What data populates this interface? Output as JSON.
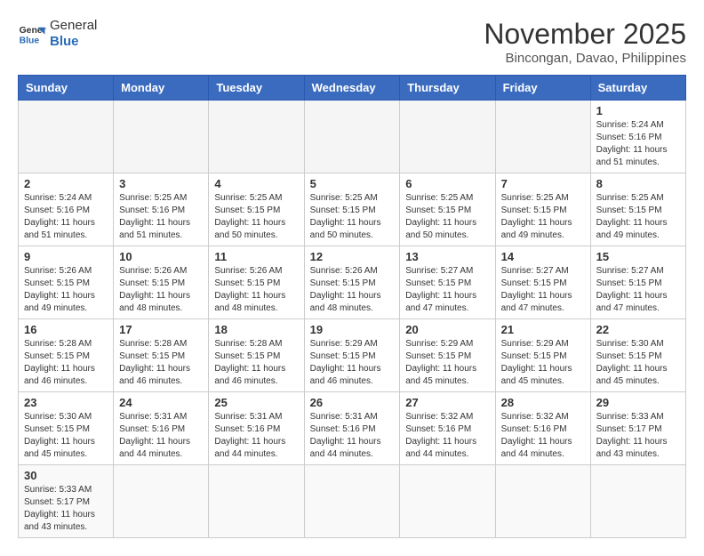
{
  "header": {
    "logo_text_general": "General",
    "logo_text_blue": "Blue",
    "month_title": "November 2025",
    "location": "Bincongan, Davao, Philippines"
  },
  "weekdays": [
    "Sunday",
    "Monday",
    "Tuesday",
    "Wednesday",
    "Thursday",
    "Friday",
    "Saturday"
  ],
  "weeks": [
    [
      {
        "day": "",
        "info": ""
      },
      {
        "day": "",
        "info": ""
      },
      {
        "day": "",
        "info": ""
      },
      {
        "day": "",
        "info": ""
      },
      {
        "day": "",
        "info": ""
      },
      {
        "day": "",
        "info": ""
      },
      {
        "day": "1",
        "info": "Sunrise: 5:24 AM\nSunset: 5:16 PM\nDaylight: 11 hours\nand 51 minutes."
      }
    ],
    [
      {
        "day": "2",
        "info": "Sunrise: 5:24 AM\nSunset: 5:16 PM\nDaylight: 11 hours\nand 51 minutes."
      },
      {
        "day": "3",
        "info": "Sunrise: 5:25 AM\nSunset: 5:16 PM\nDaylight: 11 hours\nand 51 minutes."
      },
      {
        "day": "4",
        "info": "Sunrise: 5:25 AM\nSunset: 5:15 PM\nDaylight: 11 hours\nand 50 minutes."
      },
      {
        "day": "5",
        "info": "Sunrise: 5:25 AM\nSunset: 5:15 PM\nDaylight: 11 hours\nand 50 minutes."
      },
      {
        "day": "6",
        "info": "Sunrise: 5:25 AM\nSunset: 5:15 PM\nDaylight: 11 hours\nand 50 minutes."
      },
      {
        "day": "7",
        "info": "Sunrise: 5:25 AM\nSunset: 5:15 PM\nDaylight: 11 hours\nand 49 minutes."
      },
      {
        "day": "8",
        "info": "Sunrise: 5:25 AM\nSunset: 5:15 PM\nDaylight: 11 hours\nand 49 minutes."
      }
    ],
    [
      {
        "day": "9",
        "info": "Sunrise: 5:26 AM\nSunset: 5:15 PM\nDaylight: 11 hours\nand 49 minutes."
      },
      {
        "day": "10",
        "info": "Sunrise: 5:26 AM\nSunset: 5:15 PM\nDaylight: 11 hours\nand 48 minutes."
      },
      {
        "day": "11",
        "info": "Sunrise: 5:26 AM\nSunset: 5:15 PM\nDaylight: 11 hours\nand 48 minutes."
      },
      {
        "day": "12",
        "info": "Sunrise: 5:26 AM\nSunset: 5:15 PM\nDaylight: 11 hours\nand 48 minutes."
      },
      {
        "day": "13",
        "info": "Sunrise: 5:27 AM\nSunset: 5:15 PM\nDaylight: 11 hours\nand 47 minutes."
      },
      {
        "day": "14",
        "info": "Sunrise: 5:27 AM\nSunset: 5:15 PM\nDaylight: 11 hours\nand 47 minutes."
      },
      {
        "day": "15",
        "info": "Sunrise: 5:27 AM\nSunset: 5:15 PM\nDaylight: 11 hours\nand 47 minutes."
      }
    ],
    [
      {
        "day": "16",
        "info": "Sunrise: 5:28 AM\nSunset: 5:15 PM\nDaylight: 11 hours\nand 46 minutes."
      },
      {
        "day": "17",
        "info": "Sunrise: 5:28 AM\nSunset: 5:15 PM\nDaylight: 11 hours\nand 46 minutes."
      },
      {
        "day": "18",
        "info": "Sunrise: 5:28 AM\nSunset: 5:15 PM\nDaylight: 11 hours\nand 46 minutes."
      },
      {
        "day": "19",
        "info": "Sunrise: 5:29 AM\nSunset: 5:15 PM\nDaylight: 11 hours\nand 46 minutes."
      },
      {
        "day": "20",
        "info": "Sunrise: 5:29 AM\nSunset: 5:15 PM\nDaylight: 11 hours\nand 45 minutes."
      },
      {
        "day": "21",
        "info": "Sunrise: 5:29 AM\nSunset: 5:15 PM\nDaylight: 11 hours\nand 45 minutes."
      },
      {
        "day": "22",
        "info": "Sunrise: 5:30 AM\nSunset: 5:15 PM\nDaylight: 11 hours\nand 45 minutes."
      }
    ],
    [
      {
        "day": "23",
        "info": "Sunrise: 5:30 AM\nSunset: 5:15 PM\nDaylight: 11 hours\nand 45 minutes."
      },
      {
        "day": "24",
        "info": "Sunrise: 5:31 AM\nSunset: 5:16 PM\nDaylight: 11 hours\nand 44 minutes."
      },
      {
        "day": "25",
        "info": "Sunrise: 5:31 AM\nSunset: 5:16 PM\nDaylight: 11 hours\nand 44 minutes."
      },
      {
        "day": "26",
        "info": "Sunrise: 5:31 AM\nSunset: 5:16 PM\nDaylight: 11 hours\nand 44 minutes."
      },
      {
        "day": "27",
        "info": "Sunrise: 5:32 AM\nSunset: 5:16 PM\nDaylight: 11 hours\nand 44 minutes."
      },
      {
        "day": "28",
        "info": "Sunrise: 5:32 AM\nSunset: 5:16 PM\nDaylight: 11 hours\nand 44 minutes."
      },
      {
        "day": "29",
        "info": "Sunrise: 5:33 AM\nSunset: 5:17 PM\nDaylight: 11 hours\nand 43 minutes."
      }
    ],
    [
      {
        "day": "30",
        "info": "Sunrise: 5:33 AM\nSunset: 5:17 PM\nDaylight: 11 hours\nand 43 minutes."
      },
      {
        "day": "",
        "info": ""
      },
      {
        "day": "",
        "info": ""
      },
      {
        "day": "",
        "info": ""
      },
      {
        "day": "",
        "info": ""
      },
      {
        "day": "",
        "info": ""
      },
      {
        "day": "",
        "info": ""
      }
    ]
  ]
}
